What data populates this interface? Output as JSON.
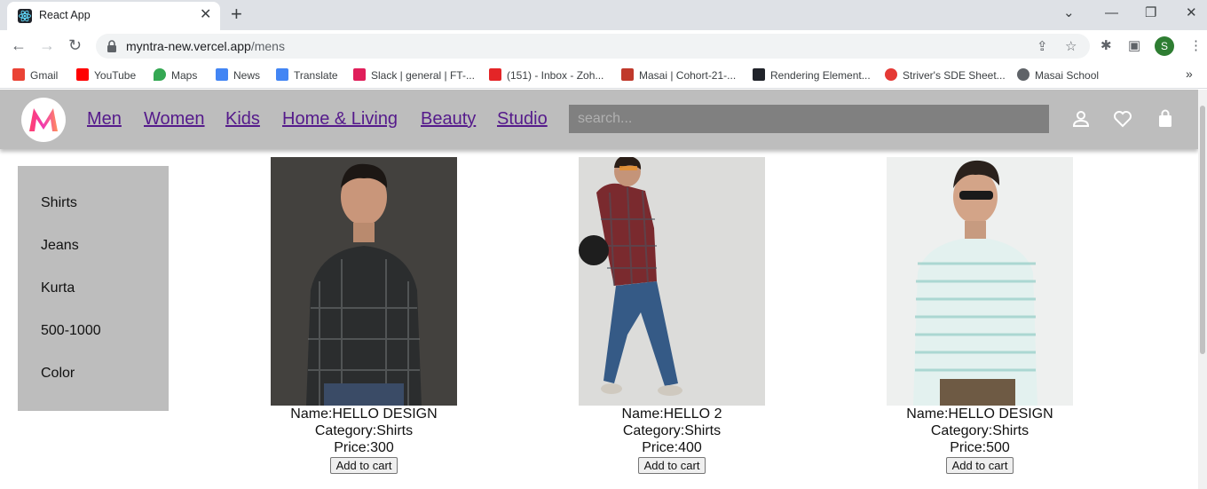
{
  "browser": {
    "tab_title": "React App",
    "url_host": "myntra-new.vercel.app",
    "url_path": "/mens",
    "profile_initial": "S",
    "bookmarks": [
      {
        "label": "Gmail",
        "icon": "gmail-icon",
        "color": "#ea4335"
      },
      {
        "label": "YouTube",
        "icon": "youtube-icon",
        "color": "#ff0000"
      },
      {
        "label": "Maps",
        "icon": "maps-icon",
        "color": "#34a853"
      },
      {
        "label": "News",
        "icon": "news-icon",
        "color": "#4285f4"
      },
      {
        "label": "Translate",
        "icon": "translate-icon",
        "color": "#4285f4"
      },
      {
        "label": "Slack | general | FT-...",
        "icon": "slack-icon",
        "color": "#e01e5a"
      },
      {
        "label": "(151) - Inbox - Zoh...",
        "icon": "zoho-icon",
        "color": "#e42527"
      },
      {
        "label": "Masai | Cohort-21-...",
        "icon": "masai-icon",
        "color": "#c0392b"
      },
      {
        "label": "Rendering Element...",
        "icon": "react-icon",
        "color": "#20232a"
      },
      {
        "label": "Striver's SDE Sheet...",
        "icon": "tuf-icon",
        "color": "#e53935"
      },
      {
        "label": "Masai School",
        "icon": "globe-icon",
        "color": "#5f6368"
      }
    ]
  },
  "navbar": {
    "links": [
      "Men",
      "Women",
      "Kids",
      "Home & Living",
      "Beauty",
      "Studio"
    ],
    "search_placeholder": "search..."
  },
  "sidebar": {
    "items": [
      "Shirts",
      "Jeans",
      "Kurta",
      "500-1000",
      "Color"
    ]
  },
  "products": [
    {
      "name": "Name:HELLO DESIGN",
      "category": "Category:Shirts",
      "price": "Price:300",
      "button": "Add to cart"
    },
    {
      "name": "Name:HELLO 2",
      "category": "Category:Shirts",
      "price": "Price:400",
      "button": "Add to cart"
    },
    {
      "name": "Name:HELLO DESIGN",
      "category": "Category:Shirts",
      "price": "Price:500",
      "button": "Add to cart"
    }
  ],
  "colors": {
    "navbar_bg": "#bdbdbd",
    "link": "#551a8b",
    "search_bg": "#808080"
  }
}
